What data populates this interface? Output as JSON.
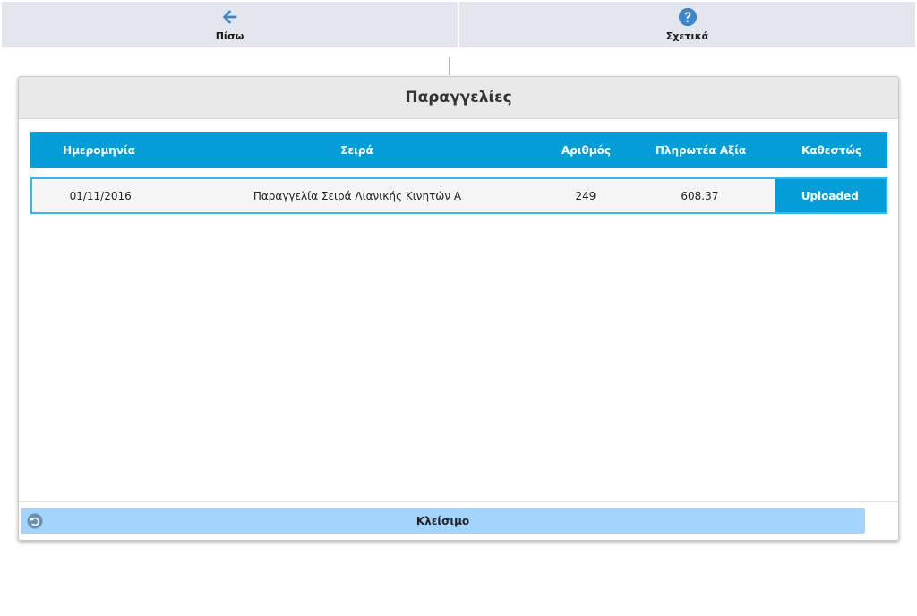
{
  "toolbar": {
    "back_label": "Πίσω",
    "back_icon": "arrow-left-icon",
    "about_label": "Σχετικά",
    "about_icon": "help-circle-icon"
  },
  "dialog": {
    "title": "Παραγγελίες",
    "close_label": "Κλείσιμο",
    "close_icon": "undo-circle-icon"
  },
  "table": {
    "columns": [
      "Ημερομηνία",
      "Σειρά",
      "Αριθμός",
      "Πληρωτέα Αξία",
      "Καθεστώς"
    ],
    "rows": [
      {
        "date": "01/11/2016",
        "series": "Παραγγελία Σειρά Λιανικής Κινητών Α",
        "number": "249",
        "amount": "608.37",
        "status": "Uploaded"
      }
    ]
  },
  "colors": {
    "accent": "#049dd8",
    "toolbar_bg": "#e3e6ef",
    "close_button_bg": "#a4d3fb",
    "icon_blue": "#3a86c8"
  }
}
